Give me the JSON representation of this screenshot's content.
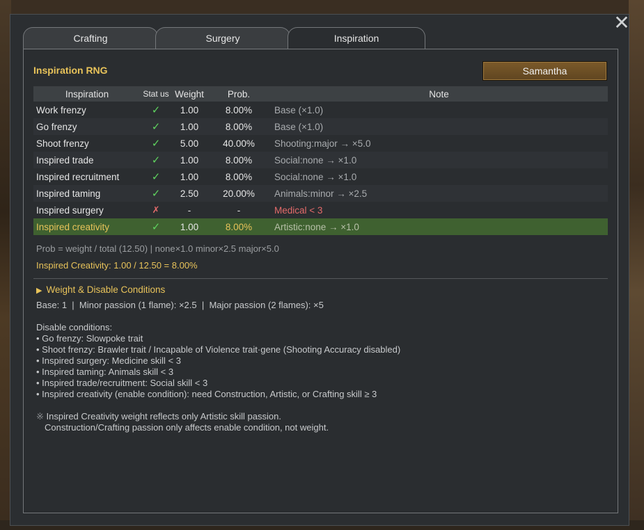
{
  "window": {
    "close_glyph": "✕"
  },
  "tabs": [
    {
      "label": "Crafting",
      "active": false
    },
    {
      "label": "Surgery",
      "active": false
    },
    {
      "label": "Inspiration",
      "active": true
    }
  ],
  "panel": {
    "title": "Inspiration RNG",
    "pawn_button": "Samantha"
  },
  "table": {
    "headers": {
      "inspiration": "Inspiration",
      "status": "Stat us",
      "weight": "Weight",
      "prob": "Prob.",
      "note": "Note"
    },
    "rows": [
      {
        "name": "Work frenzy",
        "status": "✓",
        "weight": "1.00",
        "prob": "8.00%",
        "note": "Base (×1.0)"
      },
      {
        "name": "Go frenzy",
        "status": "✓",
        "weight": "1.00",
        "prob": "8.00%",
        "note": "Base (×1.0)"
      },
      {
        "name": "Shoot frenzy",
        "status": "✓",
        "weight": "5.00",
        "prob": "40.00%",
        "note": "Shooting:major → ×5.0"
      },
      {
        "name": "Inspired trade",
        "status": "✓",
        "weight": "1.00",
        "prob": "8.00%",
        "note": "Social:none → ×1.0"
      },
      {
        "name": "Inspired recruitment",
        "status": "✓",
        "weight": "1.00",
        "prob": "8.00%",
        "note": "Social:none → ×1.0"
      },
      {
        "name": "Inspired taming",
        "status": "✓",
        "weight": "2.50",
        "prob": "20.00%",
        "note": "Animals:minor → ×2.5"
      },
      {
        "name": "Inspired surgery",
        "status": "✗",
        "weight": "-",
        "prob": "-",
        "note": "Medical < 3"
      },
      {
        "name": "Inspired creativity",
        "status": "✓",
        "weight": "1.00",
        "prob": "8.00%",
        "note": "Artistic:none → ×1.0"
      }
    ]
  },
  "formula": "Prob = weight / total (12.50) | none×1.0 minor×2.5 major×5.0",
  "result": "Inspired Creativity: 1.00 / 12.50 = 8.00%",
  "conditions": {
    "toggle_glyph": "▶",
    "header": "Weight & Disable Conditions",
    "base_line": "Base: 1  |  Minor passion (1 flame): ×2.5  |  Major passion (2 flames): ×5",
    "disable_title": "Disable conditions:",
    "disable_items": [
      "• Go frenzy: Slowpoke trait",
      "• Shoot frenzy: Brawler trait / Incapable of Violence trait·gene (Shooting Accuracy disabled)",
      "• Inspired surgery: Medicine skill < 3",
      "• Inspired taming: Animals skill < 3",
      "• Inspired trade/recruitment: Social skill < 3",
      "• Inspired creativity (enable condition): need Construction, Artistic, or Crafting skill ≥ 3"
    ],
    "note_symbol": "※",
    "note_line1": "Inspired Creativity weight reflects only Artistic skill passion.",
    "note_line2": "Construction/Crafting passion only affects enable condition, not weight."
  },
  "colors": {
    "accent": "#e8c35a",
    "check": "#5fd35f",
    "cross": "#e26a6a",
    "highlight_row": "#3f6130"
  }
}
